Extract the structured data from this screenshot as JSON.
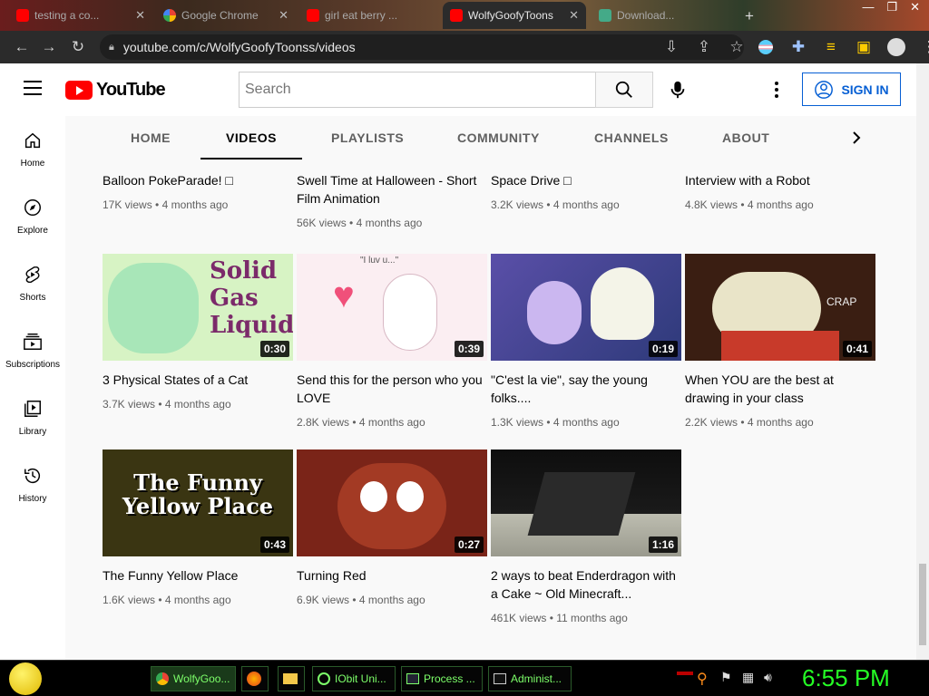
{
  "browser": {
    "tabs": [
      {
        "label": "testing a co...",
        "icon": "youtube-icon"
      },
      {
        "label": "Google Chrome",
        "icon": "google-icon"
      },
      {
        "label": "girl eat berry ...",
        "icon": "youtube-icon"
      },
      {
        "label": "WolfyGoofyToons",
        "icon": "youtube-icon",
        "active": true
      },
      {
        "label": "Download...",
        "icon": "downloads-icon"
      }
    ],
    "url": "youtube.com/c/WolfyGoofyToonss/videos"
  },
  "masthead": {
    "logo_text": "YouTube",
    "search_placeholder": "Search",
    "sign_in": "SIGN IN"
  },
  "left_nav": [
    {
      "label": "Home",
      "icon": "home-icon"
    },
    {
      "label": "Explore",
      "icon": "explore-icon"
    },
    {
      "label": "Shorts",
      "icon": "shorts-icon"
    },
    {
      "label": "Subscriptions",
      "icon": "subscriptions-icon"
    },
    {
      "label": "Library",
      "icon": "library-icon"
    },
    {
      "label": "History",
      "icon": "history-icon"
    }
  ],
  "channel_tabs": [
    "HOME",
    "VIDEOS",
    "PLAYLISTS",
    "COMMUNITY",
    "CHANNELS",
    "ABOUT"
  ],
  "videos": [
    {
      "title": "Balloon PokeParade! □",
      "views": "17K views",
      "age": "4 months ago",
      "duration": ""
    },
    {
      "title": "Swell Time at Halloween - Short Film Animation",
      "views": "56K views",
      "age": "4 months ago",
      "duration": ""
    },
    {
      "title": "Space Drive □",
      "views": "3.2K views",
      "age": "4 months ago",
      "duration": ""
    },
    {
      "title": "Interview with a Robot",
      "views": "4.8K views",
      "age": "4 months ago",
      "duration": ""
    },
    {
      "title": "3 Physical States of a Cat",
      "views": "3.7K views",
      "age": "4 months ago",
      "duration": "0:30",
      "thumb_text": "Solid Gas Liquid"
    },
    {
      "title": "Send this for the person who you LOVE",
      "views": "2.8K views",
      "age": "4 months ago",
      "duration": "0:39",
      "thumb_text": "\"I luv u...\""
    },
    {
      "title": "\"C'est la vie\", say the young folks....",
      "views": "1.3K views",
      "age": "4 months ago",
      "duration": "0:19"
    },
    {
      "title": "When YOU are the best at drawing in your class",
      "views": "2.2K views",
      "age": "4 months ago",
      "duration": "0:41",
      "thumb_text": "CRAP"
    },
    {
      "title": "The Funny Yellow Place",
      "views": "1.6K views",
      "age": "4 months ago",
      "duration": "0:43",
      "thumb_text": "The Funny Yellow Place"
    },
    {
      "title": "Turning Red",
      "views": "6.9K views",
      "age": "4 months ago",
      "duration": "0:27"
    },
    {
      "title": "2 ways to beat Enderdragon with a Cake ~ Old Minecraft...",
      "views": "461K views",
      "age": "11 months ago",
      "duration": "1:16"
    }
  ],
  "taskbar": {
    "items": [
      {
        "label": "WolfyGoo...",
        "icon": "chrome-icon"
      },
      {
        "label": "",
        "icon": "firefox-icon"
      },
      {
        "label": "",
        "icon": "folder-icon"
      },
      {
        "label": "IObit Uni...",
        "icon": "iobit-icon"
      },
      {
        "label": "Process ...",
        "icon": "process-icon"
      },
      {
        "label": "Administ...",
        "icon": "cmd-icon"
      }
    ],
    "clock": "6:55 PM"
  }
}
